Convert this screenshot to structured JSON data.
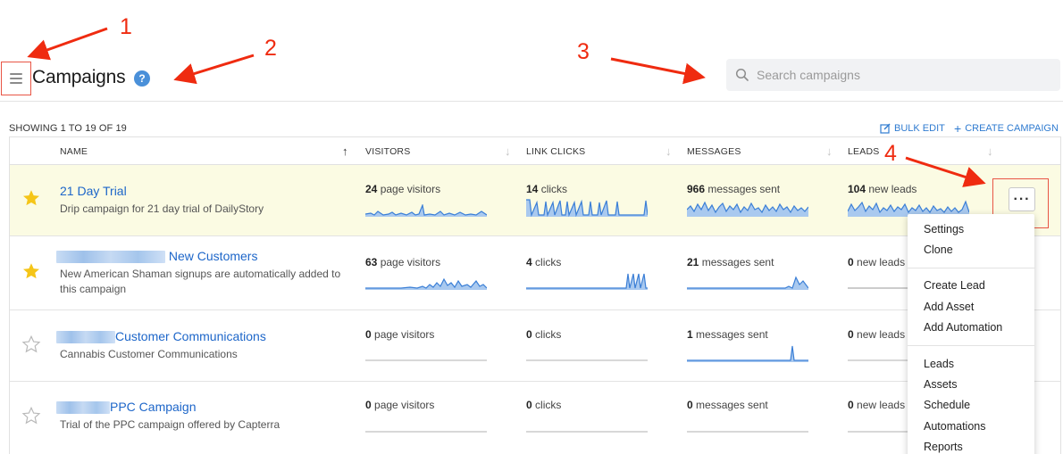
{
  "header": {
    "title": "Campaigns",
    "help_icon": "?",
    "search_placeholder": "Search campaigns"
  },
  "annotations": [
    "1",
    "2",
    "3",
    "4"
  ],
  "list": {
    "showing": "SHOWING 1 TO 19 OF 19",
    "bulk_edit": "BULK EDIT",
    "create_campaign": "CREATE CAMPAIGN"
  },
  "columns": {
    "name": "NAME",
    "visitors": "VISITORS",
    "link_clicks": "LINK CLICKS",
    "messages": "MESSAGES",
    "leads": "LEADS"
  },
  "rows": [
    {
      "starred": true,
      "name": "21 Day Trial",
      "description": "Drip campaign for 21 day trial of DailyStory",
      "visitors": "24",
      "visitors_unit": "page visitors",
      "clicks": "14",
      "clicks_unit": "clicks",
      "messages": "966",
      "messages_unit": "messages sent",
      "leads": "104",
      "leads_unit": "new leads"
    },
    {
      "starred": true,
      "name": "New Customers",
      "description": "New American Shaman signups are automatically added to this campaign",
      "visitors": "63",
      "visitors_unit": "page visitors",
      "clicks": "4",
      "clicks_unit": "clicks",
      "messages": "21",
      "messages_unit": "messages sent",
      "leads": "0",
      "leads_unit": "new leads"
    },
    {
      "starred": false,
      "name": "Customer Communications",
      "description": "Cannabis Customer Communications",
      "visitors": "0",
      "visitors_unit": "page visitors",
      "clicks": "0",
      "clicks_unit": "clicks",
      "messages": "1",
      "messages_unit": "messages sent",
      "leads": "0",
      "leads_unit": "new leads"
    },
    {
      "starred": false,
      "name": "PPC Campaign",
      "description": "Trial of the PPC campaign offered by Capterra",
      "visitors": "0",
      "visitors_unit": "page visitors",
      "clicks": "0",
      "clicks_unit": "clicks",
      "messages": "0",
      "messages_unit": "messages sent",
      "leads": "0",
      "leads_unit": "new leads"
    }
  ],
  "more_button": "···",
  "dropdown": {
    "group1": [
      "Settings",
      "Clone"
    ],
    "group2": [
      "Create Lead",
      "Add Asset",
      "Add Automation"
    ],
    "group3": [
      "Leads",
      "Assets",
      "Schedule",
      "Automations",
      "Reports"
    ]
  },
  "colors": {
    "accent_link": "#1d66c9",
    "annotation_red": "#ef2b10",
    "star_filled": "#f5c518",
    "highlight_row": "#fbfbe3",
    "sparkline": "#3b7fd6"
  }
}
